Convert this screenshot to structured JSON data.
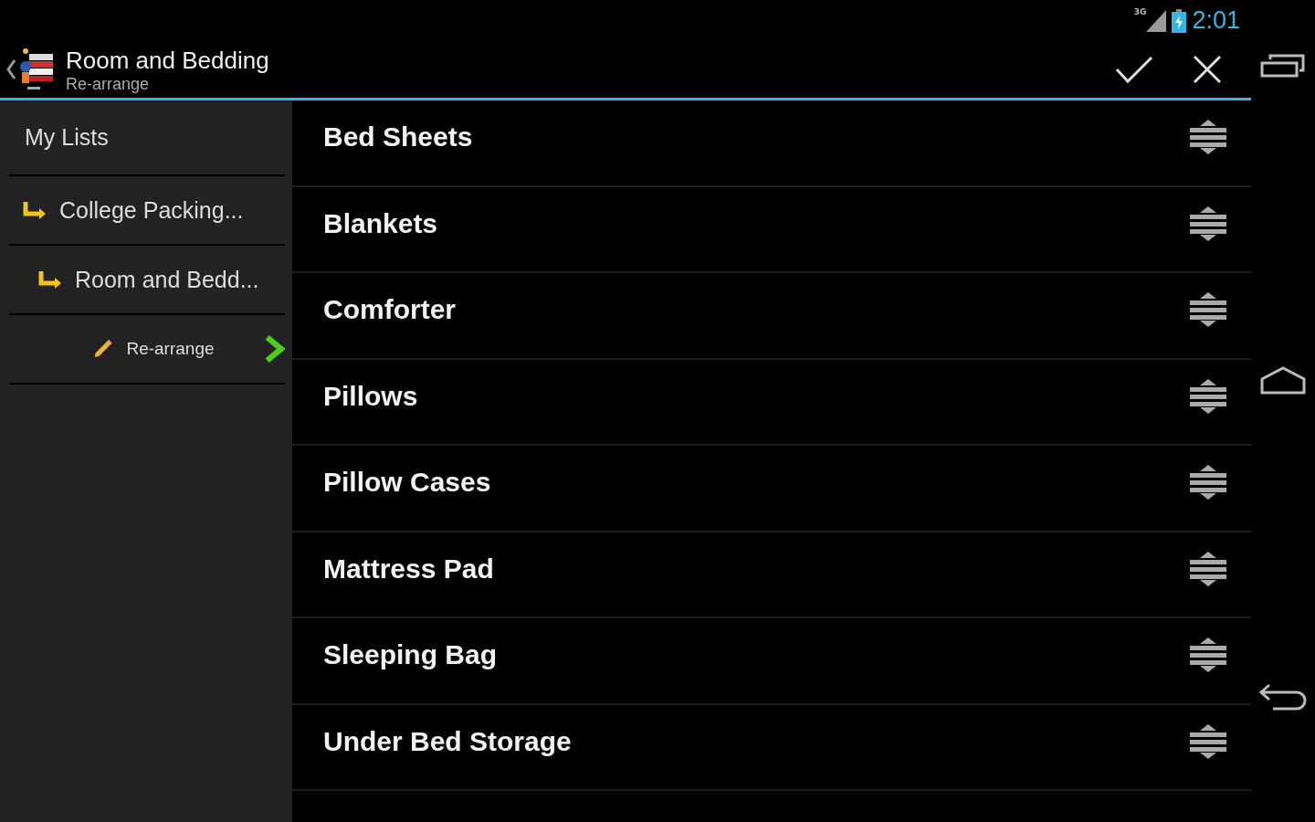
{
  "status_bar": {
    "network": "3G",
    "time": "2:01"
  },
  "action_bar": {
    "title": "Room and Bedding",
    "subtitle": "Re-arrange"
  },
  "sidebar": {
    "label": "My Lists",
    "children": [
      {
        "label": "College Packing...",
        "kind": "folder",
        "children": [
          {
            "label": "Room and Bedd...",
            "kind": "folder",
            "children": [
              {
                "label": "Re-arrange",
                "kind": "action"
              }
            ]
          }
        ]
      }
    ]
  },
  "items": [
    {
      "label": "Bed Sheets"
    },
    {
      "label": "Blankets"
    },
    {
      "label": "Comforter"
    },
    {
      "label": "Pillows"
    },
    {
      "label": "Pillow Cases"
    },
    {
      "label": "Mattress Pad"
    },
    {
      "label": "Sleeping Bag"
    },
    {
      "label": "Under Bed Storage"
    }
  ]
}
